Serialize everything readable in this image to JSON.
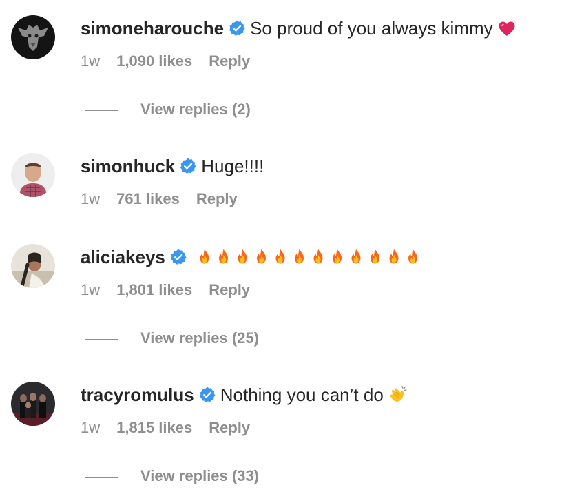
{
  "colors": {
    "text": "#262626",
    "secondary": "#8e8e8e",
    "verified_blue": "#3897f0",
    "heart_red": "#e0245e",
    "fire_orange": "#f7681d",
    "clap_yellow": "#fcc21b"
  },
  "comments": [
    {
      "username": "simoneharouche",
      "verified": true,
      "text": "So proud of you always kimmy",
      "emoji": "red-heart-icon",
      "time": "1w",
      "likes": "1,090 likes",
      "reply_label": "Reply",
      "view_replies": "View replies (2)"
    },
    {
      "username": "simonhuck",
      "verified": true,
      "text": "Huge!!!!",
      "time": "1w",
      "likes": "761 likes",
      "reply_label": "Reply"
    },
    {
      "username": "aliciakeys",
      "verified": true,
      "text": "",
      "emoji": "fire-icon",
      "emoji_count": 12,
      "time": "1w",
      "likes": "1,801 likes",
      "reply_label": "Reply",
      "view_replies": "View replies (25)"
    },
    {
      "username": "tracyromulus",
      "verified": true,
      "text": "Nothing you can’t do",
      "emoji": "clapping-hands-icon",
      "time": "1w",
      "likes": "1,815 likes",
      "reply_label": "Reply",
      "view_replies": "View replies (33)"
    }
  ]
}
